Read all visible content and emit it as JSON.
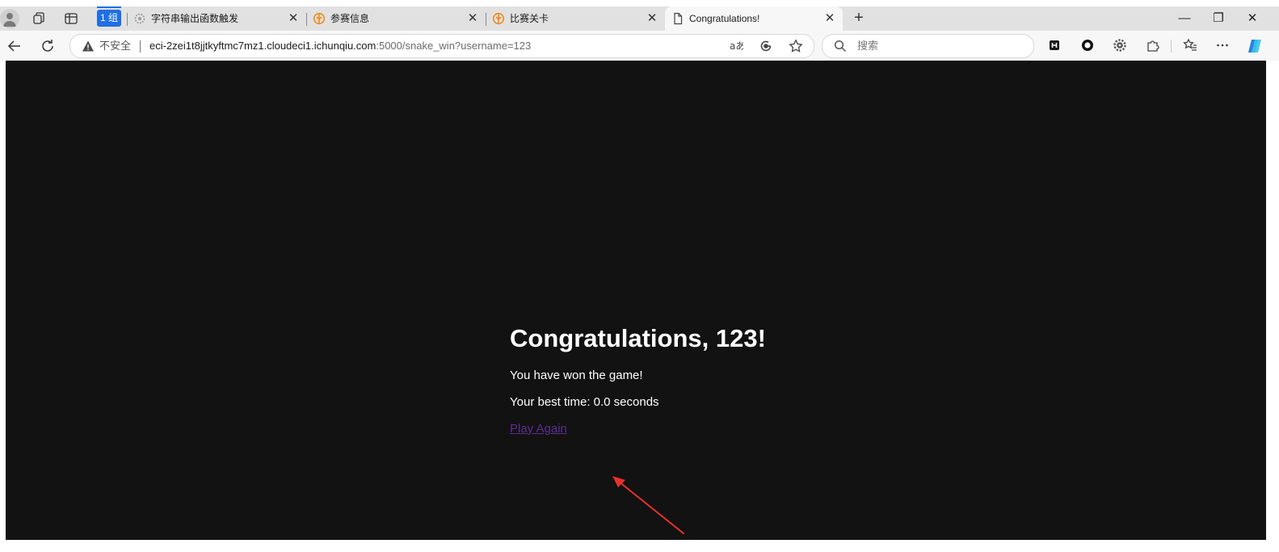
{
  "browser": {
    "tab_group_label": "1 组",
    "tabs": [
      {
        "title": "字符串输出函数触发",
        "favicon": "gear-favicon"
      },
      {
        "title": "参赛信息",
        "favicon": "ichunqiu-favicon"
      },
      {
        "title": "比赛关卡",
        "favicon": "ichunqiu-favicon"
      },
      {
        "title": "Congratulations!",
        "favicon": "page-favicon",
        "active": true
      }
    ],
    "close_glyph": "✕",
    "new_tab_glyph": "+",
    "window_controls": {
      "minimize": "—",
      "restore": "❐",
      "close": "✕"
    }
  },
  "address_bar": {
    "security_label": "不安全",
    "url_host": "eci-2zei1t8jjtkyftmc7mz1.cloudeci1.ichunqiu.com",
    "url_rest": ":5000/snake_win?username=123"
  },
  "search": {
    "placeholder": "搜索"
  },
  "page": {
    "heading": "Congratulations, 123!",
    "message": "You have won the game!",
    "best_time": "Your best time: 0.0 seconds",
    "play_again": "Play Again"
  },
  "colors": {
    "page_background": "#121212",
    "text": "#ffffff",
    "link_visited": "#5c2d91",
    "annotation_arrow": "#e8302a",
    "tab_group": "#1f6fe5"
  }
}
